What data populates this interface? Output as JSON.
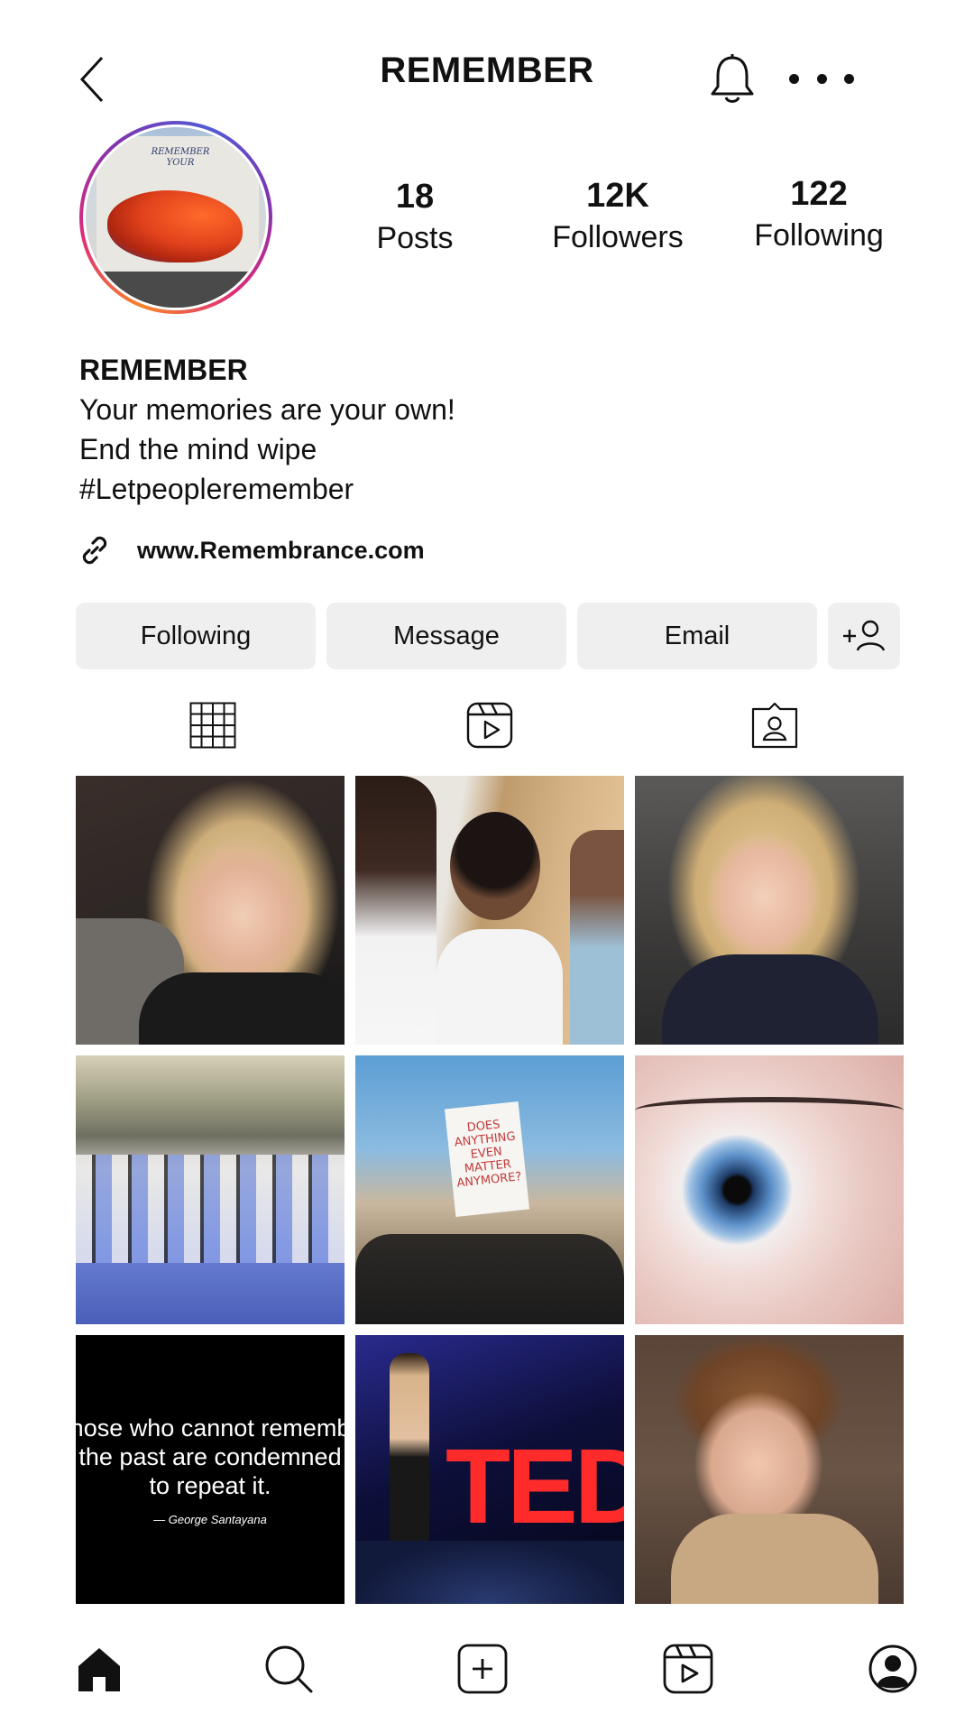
{
  "header": {
    "title": "REMEMBER",
    "icons": {
      "back": "chevron-left-icon",
      "notifications": "bell-icon",
      "more": "more-dots-icon"
    }
  },
  "profile": {
    "avatar_text": "REMEMBER YOUR",
    "stats": {
      "posts": {
        "value": "18",
        "label": "Posts"
      },
      "followers": {
        "value": "12K",
        "label": "Followers"
      },
      "following": {
        "value": "122",
        "label": "Following"
      }
    },
    "bio": {
      "name": "REMEMBER",
      "lines": [
        "Your memories are your own!",
        "End the mind wipe",
        "#Letpeopleremember"
      ]
    },
    "link": {
      "icon": "link-icon",
      "text": "www.Remembrance.com"
    }
  },
  "actions": {
    "following_label": "Following",
    "message_label": "Message",
    "email_label": "Email",
    "add_user_icon": "add-user-icon"
  },
  "tabs": [
    {
      "name": "posts-grid",
      "icon": "grid-icon"
    },
    {
      "name": "reels",
      "icon": "reels-icon"
    },
    {
      "name": "tagged",
      "icon": "tagged-person-icon"
    }
  ],
  "posts": {
    "protest_sign_text": "DOES ANYTHING EVEN MATTER ANYMORE?",
    "quote": {
      "line1": "hose who cannot rememb",
      "line2": "the past are condemned",
      "line3": "to repeat it.",
      "author": "— George Santayana"
    },
    "ted_text": "TED"
  },
  "bottom_nav": {
    "home_icon": "home-icon",
    "search_icon": "search-icon",
    "create_icon": "create-post-icon",
    "reels_icon": "reels-icon",
    "profile_icon": "profile-icon"
  },
  "colors": {
    "button_bg": "#efefef",
    "avatar_ring": "#dd2a7b",
    "text": "#111111"
  }
}
